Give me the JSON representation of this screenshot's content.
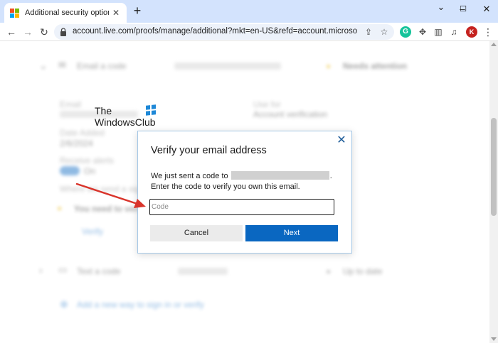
{
  "browser": {
    "tab": {
      "title": "Additional security options"
    },
    "url": "account.live.com/proofs/manage/additional?mkt=en-US&refd=account.microsoft.com&r...",
    "avatar_letter": "K",
    "grammarly_letter": "G",
    "icons": [
      "back-arrow-icon",
      "forward-arrow-icon",
      "reload-icon",
      "lock-icon",
      "share-icon",
      "star-icon",
      "extensions-puzzle-icon",
      "side-panel-icon",
      "kebab-menu-icon"
    ]
  },
  "background": {
    "method1": {
      "label": "Email a code",
      "status": "Needs attention"
    },
    "fields": {
      "email_label": "Email",
      "use_label": "Use for",
      "use_value": "Account verification",
      "date_label": "Date Added",
      "date_value": "2/6/2024",
      "toggle_label": "Receive alerts",
      "toggle_value": "On",
      "notice_line": "Where we send a sign-in code",
      "warning": "You need to verify",
      "verify_link": "Verify"
    },
    "method2": {
      "label": "Text a code",
      "status": "Up to date"
    },
    "add_link": "Add a new way to sign in or verify"
  },
  "watermark": {
    "line1": "The",
    "line2": "WindowsClub"
  },
  "dialog": {
    "title": "Verify your email address",
    "desc_before": "We just sent a code to",
    "desc_after": ". Enter the code to verify you own this email.",
    "code_placeholder": "Code",
    "cancel_label": "Cancel",
    "next_label": "Next"
  },
  "colors": {
    "accent": "#0a67c1",
    "tabstrip": "#d3e3fd",
    "annotation_arrow": "#d9342b",
    "ms_red": "#f25022",
    "ms_green": "#7fba00",
    "ms_blue": "#00a4ef",
    "ms_yellow": "#ffb900"
  }
}
